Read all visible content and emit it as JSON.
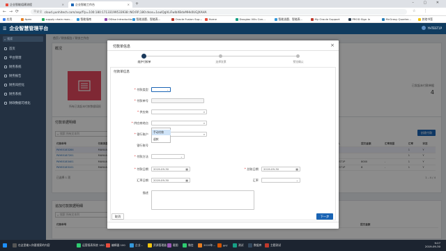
{
  "browser": {
    "tabs": [
      {
        "label": "企业智能组建流程"
      },
      {
        "label": "企业智能工作台"
      }
    ],
    "address": {
      "security_label": "不安全",
      "url": "cloud.yunhitech.com/sep/f?p=100:180:17133199533938::NO:RP,180:dsos=1oulQgVLiFwIbXBdxMHk0UGJXAHA"
    },
    "bookmarks": [
      {
        "label": "应用",
        "color": "#4285f4"
      },
      {
        "label": "Apex",
        "color": "#e67e22"
      },
      {
        "label": "supply chain man...",
        "color": "#27ae60"
      },
      {
        "label": "智能指南",
        "color": "#3498db"
      },
      {
        "label": "ODiso Introductio...",
        "color": "#8e44ad"
      },
      {
        "label": "智能选题、智能表...",
        "color": "#3498db"
      },
      {
        "label": "Oracle Fusion Sup...",
        "color": "#c0392b"
      },
      {
        "label": "Home",
        "color": "#e74c3c"
      },
      {
        "label": "Douglas Vills Con...",
        "color": "#16a085"
      },
      {
        "label": "智能选题、智能表...",
        "color": "#3498db"
      },
      {
        "label": "My Oracle Support",
        "color": "#c0392b"
      },
      {
        "label": "PROD Sign In",
        "color": "#2c3e50"
      },
      {
        "label": "McGrasy Quarter...",
        "color": "#2980b9"
      },
      {
        "label": "其他书签",
        "color": "#f1c40f"
      }
    ]
  },
  "app": {
    "title": "企业智慧管理平台",
    "user": "YHTEST1P"
  },
  "sidebar": {
    "search_placeholder": "搜索",
    "items": [
      {
        "label": "首页"
      },
      {
        "label": "平台管理"
      },
      {
        "label": "财务系统"
      },
      {
        "label": "财务报告"
      },
      {
        "label": "财务风控化"
      },
      {
        "label": "财务系统"
      },
      {
        "label": "财政数据可视化"
      }
    ]
  },
  "main": {
    "breadcrumb": "首页 / 财务报告 / 财务工作台",
    "section_title": "概况",
    "summary_card_text": "所有已发起未付款数据填报",
    "summary_right_label": "已发起未付款单据",
    "summary_right_value": "4",
    "table_title": "付款单据明细",
    "search_placeholder": "搜索 所有文本列",
    "create_button": "创建付款",
    "columns": [
      "付款单号",
      "付款类型",
      "日期",
      "金额",
      "币种",
      "状态"
    ],
    "right_columns": [
      "提交人",
      "提交金额",
      "汇率类型",
      "汇率",
      "状态"
    ],
    "rows": [
      {
        "id": "PAY65183284",
        "type": "MANUAL",
        "submitter": "",
        "amount": "",
        "rate_type": "",
        "rate": "1",
        "status": "Y"
      },
      {
        "id": "PAY65187201",
        "type": "MANUAL",
        "submitter": "",
        "amount": "",
        "rate_type": "",
        "rate": "1",
        "status": "Y"
      },
      {
        "id": "PAY65183401",
        "type": "MANUAL",
        "submitter": "YHTEST1P",
        "amount": "8000",
        "rate_type": "-",
        "rate": "1",
        "status": "Y"
      },
      {
        "id": "PAY65183101",
        "type": "MANUAL",
        "submitter": "YHTEST1P",
        "amount": "8",
        "rate_type": "-",
        "rate": "1",
        "status": "Y"
      }
    ],
    "pagination_left": "已选择 1 项",
    "pagination_right": "1 - 4 / 4",
    "lower_title": "追加付款数据明细",
    "lower_search_placeholder": "搜索 所有文本列",
    "lower_columns": [
      "付款单号",
      "付款类型",
      "行号",
      "金额",
      "税率",
      "提交金额"
    ]
  },
  "modal": {
    "title": "付款单信息",
    "steps": [
      {
        "label": "维护付款单"
      },
      {
        "label": "选择发票"
      },
      {
        "label": "预览确认"
      }
    ],
    "section_title": "付款单信息",
    "fields": {
      "pay_type_label": "付款类型",
      "pay_type_value": "",
      "pay_type_options": [
        "手动付款",
        "退款"
      ],
      "pay_no_label": "付款单号",
      "supplier_label": "供应商",
      "supplier_site_label": "供应商地点",
      "bank_account_label": "银行账户",
      "bank_no_label": "银行账号",
      "pay_method_label": "付款方法",
      "pay_date_label": "付款日期",
      "pay_date_value": "2019-09-30",
      "gl_date_label": "总账日期",
      "gl_date_value": "2019-09-30",
      "rate_date_label": "汇率日期",
      "rate_date_value": "2019-09-30",
      "rate_label": "汇率",
      "desc_label": "描述"
    },
    "cancel_button": "取消",
    "next_button": "下一步",
    "close_label": "×"
  },
  "taskbar": {
    "items": [
      {
        "label": "开始",
        "color": "#1e90ff"
      },
      {
        "label": "在这里输入你要搜索的内容",
        "color": "#555"
      },
      {
        "label": "运营报表系统 18G",
        "color": "#2ecc71"
      },
      {
        "label": "编辑器 100",
        "color": "#e74c3c"
      },
      {
        "label": "企业...",
        "color": "#3498db"
      },
      {
        "label": "资源管理器",
        "color": "#f1c40f"
      },
      {
        "label": "截图",
        "color": "#9b59b6"
      },
      {
        "label": "微信",
        "color": "#2ecc71"
      },
      {
        "label": "2019年...",
        "color": "#e67e22"
      },
      {
        "label": "PPT",
        "color": "#d35400"
      },
      {
        "label": "测试",
        "color": "#16a085"
      },
      {
        "label": "数据库",
        "color": "#34495e"
      },
      {
        "label": "主题测试",
        "color": "#c0392b"
      }
    ],
    "time": "9:27",
    "date": "2019-09-30"
  }
}
